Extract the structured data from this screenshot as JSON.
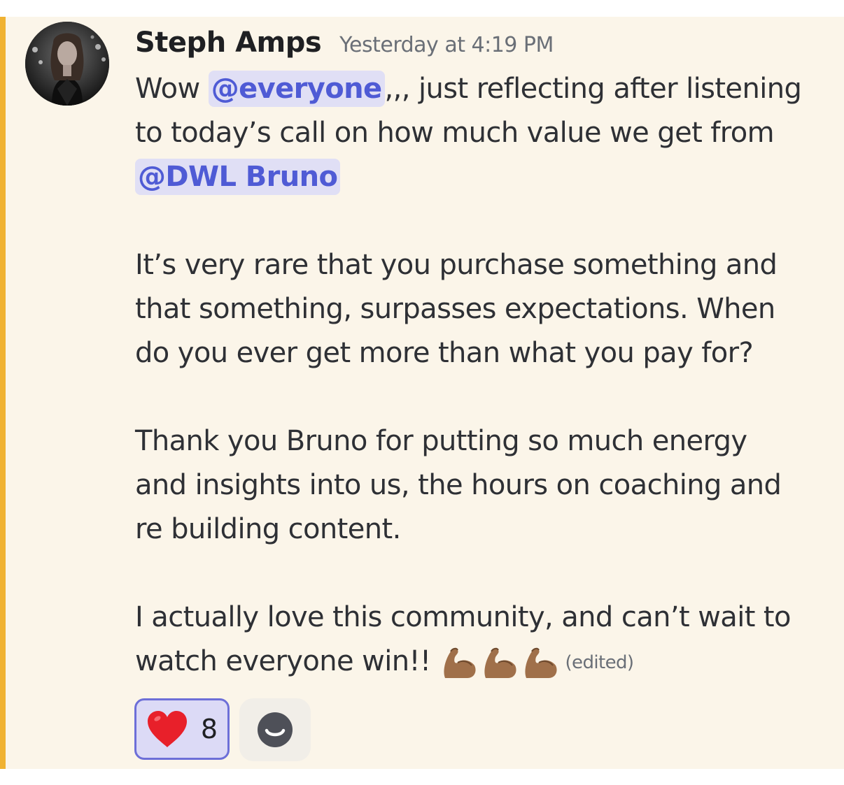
{
  "colors": {
    "message_background": "#fbf5e9",
    "highlight_bar": "#f0b232",
    "mention_text": "#4f5bd5",
    "mention_background": "#e0dff5",
    "reaction_border": "#6d6fd8",
    "reaction_background": "#dcdaf6"
  },
  "message": {
    "author": "Steph Amps",
    "timestamp": "Yesterday at 4:19 PM",
    "lines": {
      "l1_pre": "Wow ",
      "l1_mention": "@everyone",
      "l1_post": ",,, just reflecting after listening",
      "l2": "to today’s call on how much value we get from",
      "l3_mention": "@DWL Bruno",
      "l5": "It’s very rare that you purchase something and",
      "l6": "that something, surpasses expectations.  When",
      "l7": "do you ever get more than what you pay for?",
      "l9": "Thank you Bruno for putting so much energy",
      "l10": "and insights into us, the hours on coaching and",
      "l11": "re building content.",
      "l13": "I actually love this community, and can’t wait to",
      "l14": "watch everyone win!!"
    },
    "trailing_emoji": [
      "flexed-biceps-medium-dark",
      "flexed-biceps-medium-dark",
      "flexed-biceps-medium-dark"
    ],
    "edited_label": "(edited)"
  },
  "reactions": [
    {
      "emoji": "red-heart",
      "count": "8",
      "active": true
    }
  ],
  "add_reaction_icon": "smiley-add-reaction-icon"
}
